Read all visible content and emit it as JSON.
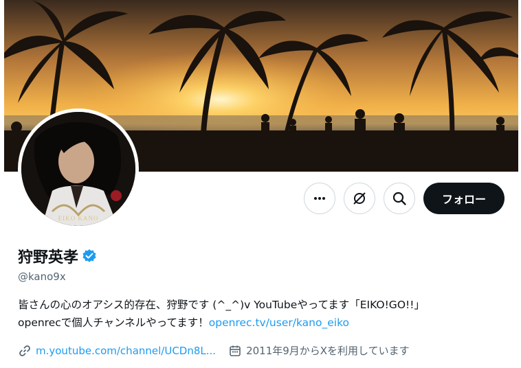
{
  "profile": {
    "display_name": "狩野英孝",
    "handle": "@kano9x",
    "verified": true,
    "avatar_caption": "EIKO KANO",
    "bio_line1": "皆さんの心のオアシス的存在、狩野です (^_^)v YouTubeやってます「EIKO!GO!!」",
    "bio_line2_text": "openrecで個人チャンネルやってます！",
    "bio_line2_link": "openrec.tv/user/kano_eiko",
    "website": "m.youtube.com/channel/UCDn8L...",
    "joined": "2011年9月からXを利用しています"
  },
  "actions": {
    "more_icon": "more-horizontal-icon",
    "grok_icon": "grok-icon",
    "search_icon": "search-icon",
    "follow_label": "フォロー"
  },
  "colors": {
    "accent": "#1d9bf0",
    "text_primary": "#0f1419",
    "text_secondary": "#536471",
    "button_dark": "#0f1419",
    "border": "#cfd9de"
  }
}
